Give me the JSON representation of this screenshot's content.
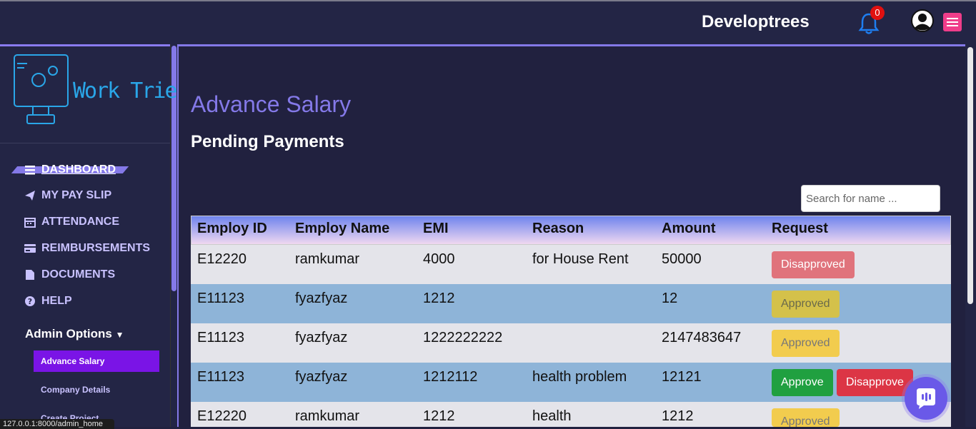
{
  "header": {
    "brand": "Developtrees",
    "notification_count": "0"
  },
  "sidebar": {
    "logo_text": "Work Tried",
    "items": [
      {
        "label": "DASHBOARD",
        "icon": "bars-icon"
      },
      {
        "label": "MY PAY SLIP",
        "icon": "paper-plane-icon"
      },
      {
        "label": "ATTENDANCE",
        "icon": "calendar-icon"
      },
      {
        "label": "REIMBURSEMENTS",
        "icon": "credit-card-icon"
      },
      {
        "label": "DOCUMENTS",
        "icon": "file-icon"
      },
      {
        "label": "HELP",
        "icon": "question-circle-icon"
      }
    ],
    "admin_options": "Admin Options",
    "sub_items": [
      {
        "label": "Advance Salary"
      },
      {
        "label": "Company Details"
      },
      {
        "label": "Create Project"
      }
    ]
  },
  "status_url": "127.0.0.1:8000/admin_home",
  "main": {
    "title": "Advance Salary",
    "section": "Pending Payments",
    "search_placeholder": "Search for name ..."
  },
  "table": {
    "headers": [
      "Employ ID",
      "Employ Name",
      "EMI",
      "Reason",
      "Amount",
      "Request"
    ],
    "rows": [
      {
        "id": "E12220",
        "name": "ramkumar",
        "emi": "4000",
        "reason": "for House Rent",
        "amount": "50000",
        "actions": [
          "Disapproved"
        ]
      },
      {
        "id": "E11123",
        "name": "fyazfyaz",
        "emi": "1212",
        "reason": "",
        "amount": "12",
        "actions": [
          "Approved"
        ]
      },
      {
        "id": "E11123",
        "name": "fyazfyaz",
        "emi": "1222222222",
        "reason": "",
        "amount": "2147483647",
        "actions": [
          "Approved"
        ]
      },
      {
        "id": "E11123",
        "name": "fyazfyaz",
        "emi": "1212112",
        "reason": "health problem",
        "amount": "12121",
        "actions": [
          "Approve",
          "Disapprove"
        ]
      },
      {
        "id": "E12220",
        "name": "ramkumar",
        "emi": "1212",
        "reason": "health",
        "amount": "1212",
        "actions": [
          "Approved"
        ]
      }
    ]
  },
  "colors": {
    "accent": "#8479e8",
    "approve": "#20a040",
    "disapprove": "#dc3545",
    "approved": "#f2cc4e"
  }
}
